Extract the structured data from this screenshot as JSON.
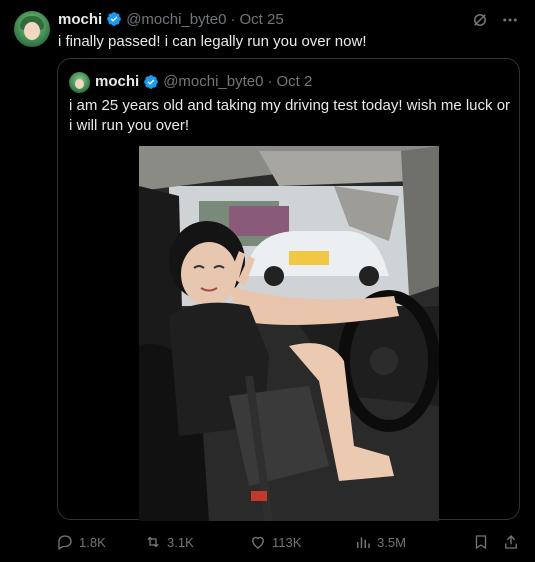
{
  "tweet": {
    "author_name": "mochi",
    "handle": "@mochi_byte0",
    "separator": "·",
    "date": "Oct 25",
    "text": "i finally passed! i can legally run you over now!"
  },
  "quoted": {
    "author_name": "mochi",
    "handle": "@mochi_byte0",
    "separator": "·",
    "date": "Oct 2",
    "text": "i am 25 years old and taking my driving test today! wish me luck or i will run you over!"
  },
  "actions": {
    "replies": "1.8K",
    "reposts": "3.1K",
    "likes": "113K",
    "views": "3.5M"
  },
  "icons": {
    "grok": "grok-icon",
    "more": "more-icon",
    "verified": "verified-badge-icon",
    "reply": "reply-icon",
    "repost": "repost-icon",
    "like": "heart-icon",
    "views": "views-icon",
    "bookmark": "bookmark-icon",
    "share": "share-icon"
  },
  "colors": {
    "background": "#000000",
    "text": "#e7e9ea",
    "muted": "#71767b",
    "border": "#2f3336",
    "verified": "#1d9bf0"
  }
}
